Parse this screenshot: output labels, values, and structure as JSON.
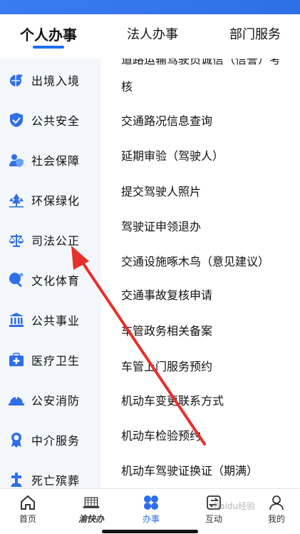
{
  "tabs": [
    {
      "label": "个人办事",
      "active": true
    },
    {
      "label": "法人办事",
      "active": false
    },
    {
      "label": "部门服务",
      "active": false
    }
  ],
  "sidebar": {
    "items": [
      {
        "label": "出境入境",
        "icon": "globe-plane-icon"
      },
      {
        "label": "公共安全",
        "icon": "shield-check-icon"
      },
      {
        "label": "社会保障",
        "icon": "person-shield-icon"
      },
      {
        "label": "环保绿化",
        "icon": "trees-icon"
      },
      {
        "label": "司法公正",
        "icon": "scales-icon"
      },
      {
        "label": "文化体育",
        "icon": "ping-pong-icon"
      },
      {
        "label": "公共事业",
        "icon": "institution-icon"
      },
      {
        "label": "医疗卫生",
        "icon": "medical-kit-icon"
      },
      {
        "label": "公安消防",
        "icon": "helmet-icon"
      },
      {
        "label": "中介服务",
        "icon": "medal-icon"
      },
      {
        "label": "死亡殡葬",
        "icon": "cross-icon"
      }
    ]
  },
  "main": {
    "partial_top_line": "道路运输驾驶员诚信（信誉）考",
    "items": [
      "核",
      "交通路况信息查询",
      "延期审验（驾驶人）",
      "提交驾驶人照片",
      "驾驶证申领退办",
      "交通设施啄木鸟（意见建议）",
      "交通事故复核申请",
      "车管政务相关备案",
      "车管上门服务预约",
      "机动车变更联系方式",
      "机动车检验预约",
      "机动车驾驶证换证（期满）"
    ]
  },
  "bottom_nav": {
    "items": [
      {
        "label": "首页",
        "icon": "home-icon",
        "active": false
      },
      {
        "label": "渝快办",
        "icon": "building-logo-icon",
        "active": false
      },
      {
        "label": "办事",
        "icon": "grid-icon",
        "active": true
      },
      {
        "label": "互动",
        "icon": "exchange-icon",
        "active": false
      },
      {
        "label": "我的",
        "icon": "user-icon",
        "active": false
      }
    ]
  },
  "colors": {
    "accent": "#1d6ff2",
    "sidebar_bg": "#f3f6fb",
    "arrow": "#e8302a"
  },
  "watermark": "Baidu经验"
}
